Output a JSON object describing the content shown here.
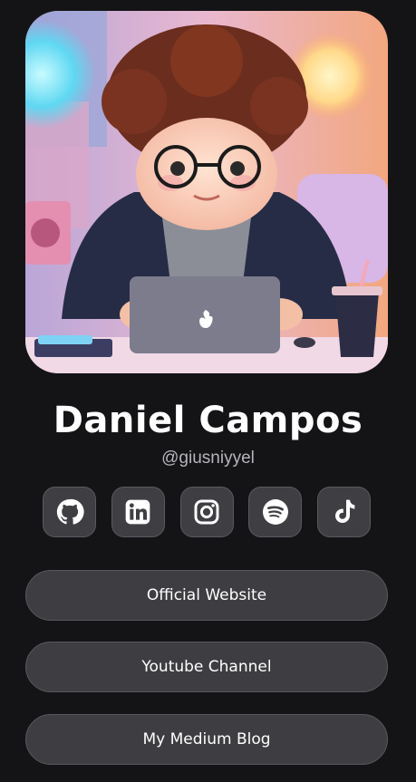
{
  "profile": {
    "name": "Daniel Campos",
    "handle": "@giusniyyel"
  },
  "socials": [
    {
      "icon": "github-icon"
    },
    {
      "icon": "linkedin-icon"
    },
    {
      "icon": "instagram-icon"
    },
    {
      "icon": "spotify-icon"
    },
    {
      "icon": "tiktok-icon"
    }
  ],
  "links": [
    {
      "label": "Official Website"
    },
    {
      "label": "Youtube Channel"
    },
    {
      "label": "My Medium Blog"
    }
  ],
  "colors": {
    "background": "#141416",
    "button": "#3e3e42",
    "border": "#57575d",
    "handle": "#b5b5bb"
  }
}
